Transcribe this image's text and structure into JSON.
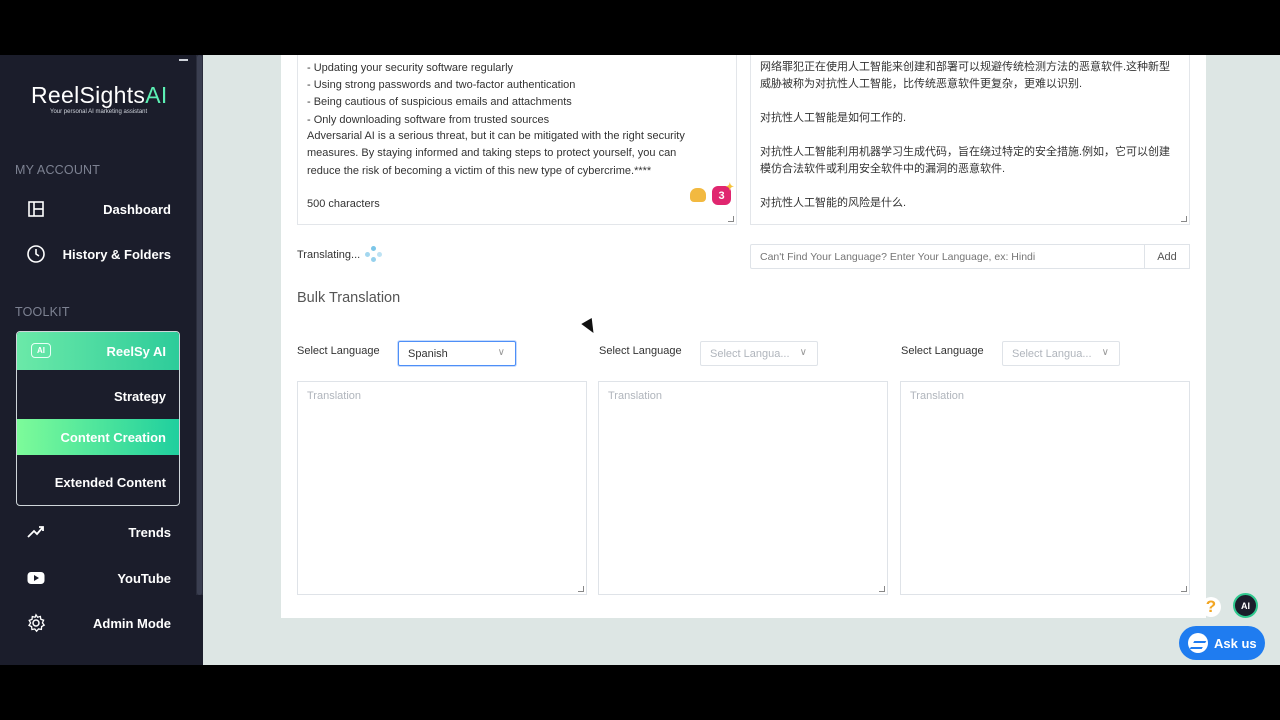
{
  "brand": {
    "name_main": "ReelSights",
    "name_accent": "AI",
    "tagline": "Your personal AI marketing assistant"
  },
  "sidebar": {
    "my_account_label": "MY ACCOUNT",
    "toolkit_label": "TOOLKIT",
    "account_items": [
      {
        "label": "Dashboard",
        "icon": "dashboard-icon"
      },
      {
        "label": "History & Folders",
        "icon": "clock-icon"
      }
    ],
    "toolkit_items": {
      "reelsy": "ReelSy AI",
      "strategy": "Strategy",
      "content_creation": "Content Creation",
      "extended_content": "Extended Content"
    },
    "bottom_items": [
      {
        "label": "Trends",
        "icon": "trending-icon"
      },
      {
        "label": "YouTube",
        "icon": "youtube-icon"
      },
      {
        "label": "Admin Mode",
        "icon": "gear-icon"
      }
    ]
  },
  "source": {
    "bullets": [
      "- Updating your security software regularly",
      "- Using strong passwords and two-factor authentication",
      "- Being cautious of suspicious emails and attachments",
      "- Only downloading software from trusted sources"
    ],
    "paragraph_lines": [
      "Adversarial AI is a serious threat, but it can be mitigated with the right security",
      "measures. By staying informed and taking steps to protect yourself, you can",
      "reduce the risk of becoming a victim of this new type of cybercrime.****"
    ],
    "char_count": "500 characters",
    "emoji_badge": "3"
  },
  "target": {
    "lines": [
      "网络罪犯正在使用人工智能来创建和部署可以规避传统检测方法的恶意软件.这种新型",
      "威胁被称为对抗性人工智能，比传统恶意软件更复杂，更难以识别.",
      "",
      "对抗性人工智能是如何工作的.",
      "",
      "对抗性人工智能利用机器学习生成代码，旨在绕过特定的安全措施.例如，它可以创建",
      "模仿合法软件或利用安全软件中的漏洞的恶意软件.",
      "",
      "对抗性人工智能的风险是什么."
    ]
  },
  "status": {
    "translating": "Translating..."
  },
  "custom_language": {
    "placeholder": "Can't Find Your Language? Enter Your Language, ex: Hindi",
    "add_label": "Add"
  },
  "bulk": {
    "title": "Bulk Translation",
    "columns": [
      {
        "label": "Select Language",
        "value": "Spanish",
        "placeholder": "",
        "translation_placeholder": "Translation"
      },
      {
        "label": "Select Language",
        "value": "",
        "placeholder": "Select Langua...",
        "translation_placeholder": "Translation"
      },
      {
        "label": "Select Language",
        "value": "",
        "placeholder": "Select Langua...",
        "translation_placeholder": "Translation"
      }
    ]
  },
  "widgets": {
    "help": "?",
    "ai": "AI",
    "ask_us": "Ask us"
  },
  "colors": {
    "sidebar_bg": "#1b1d2b",
    "accent_green": "#2dcc9a",
    "messenger_blue": "#1f7cf0"
  }
}
